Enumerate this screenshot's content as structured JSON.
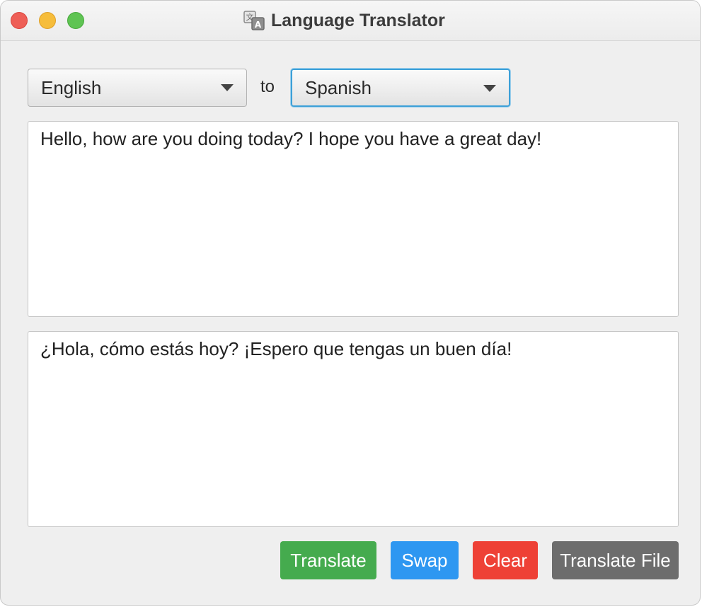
{
  "window": {
    "title": "Language Translator",
    "icon": "translate-icon"
  },
  "language_bar": {
    "source_language": "English",
    "separator": "to",
    "target_language": "Spanish"
  },
  "input": {
    "text": "Hello, how are you doing today? I hope you have a great day!"
  },
  "output": {
    "text": "¿Hola, cómo estás hoy? ¡Espero que tengas un buen día!"
  },
  "buttons": {
    "translate": "Translate",
    "swap": "Swap",
    "clear": "Clear",
    "translate_file": "Translate File"
  },
  "colors": {
    "translate": "#45ab4e",
    "swap": "#2e97f1",
    "clear": "#ee4136",
    "translate_file": "#6d6d6d",
    "focus_ring": "#3ca0d8"
  }
}
